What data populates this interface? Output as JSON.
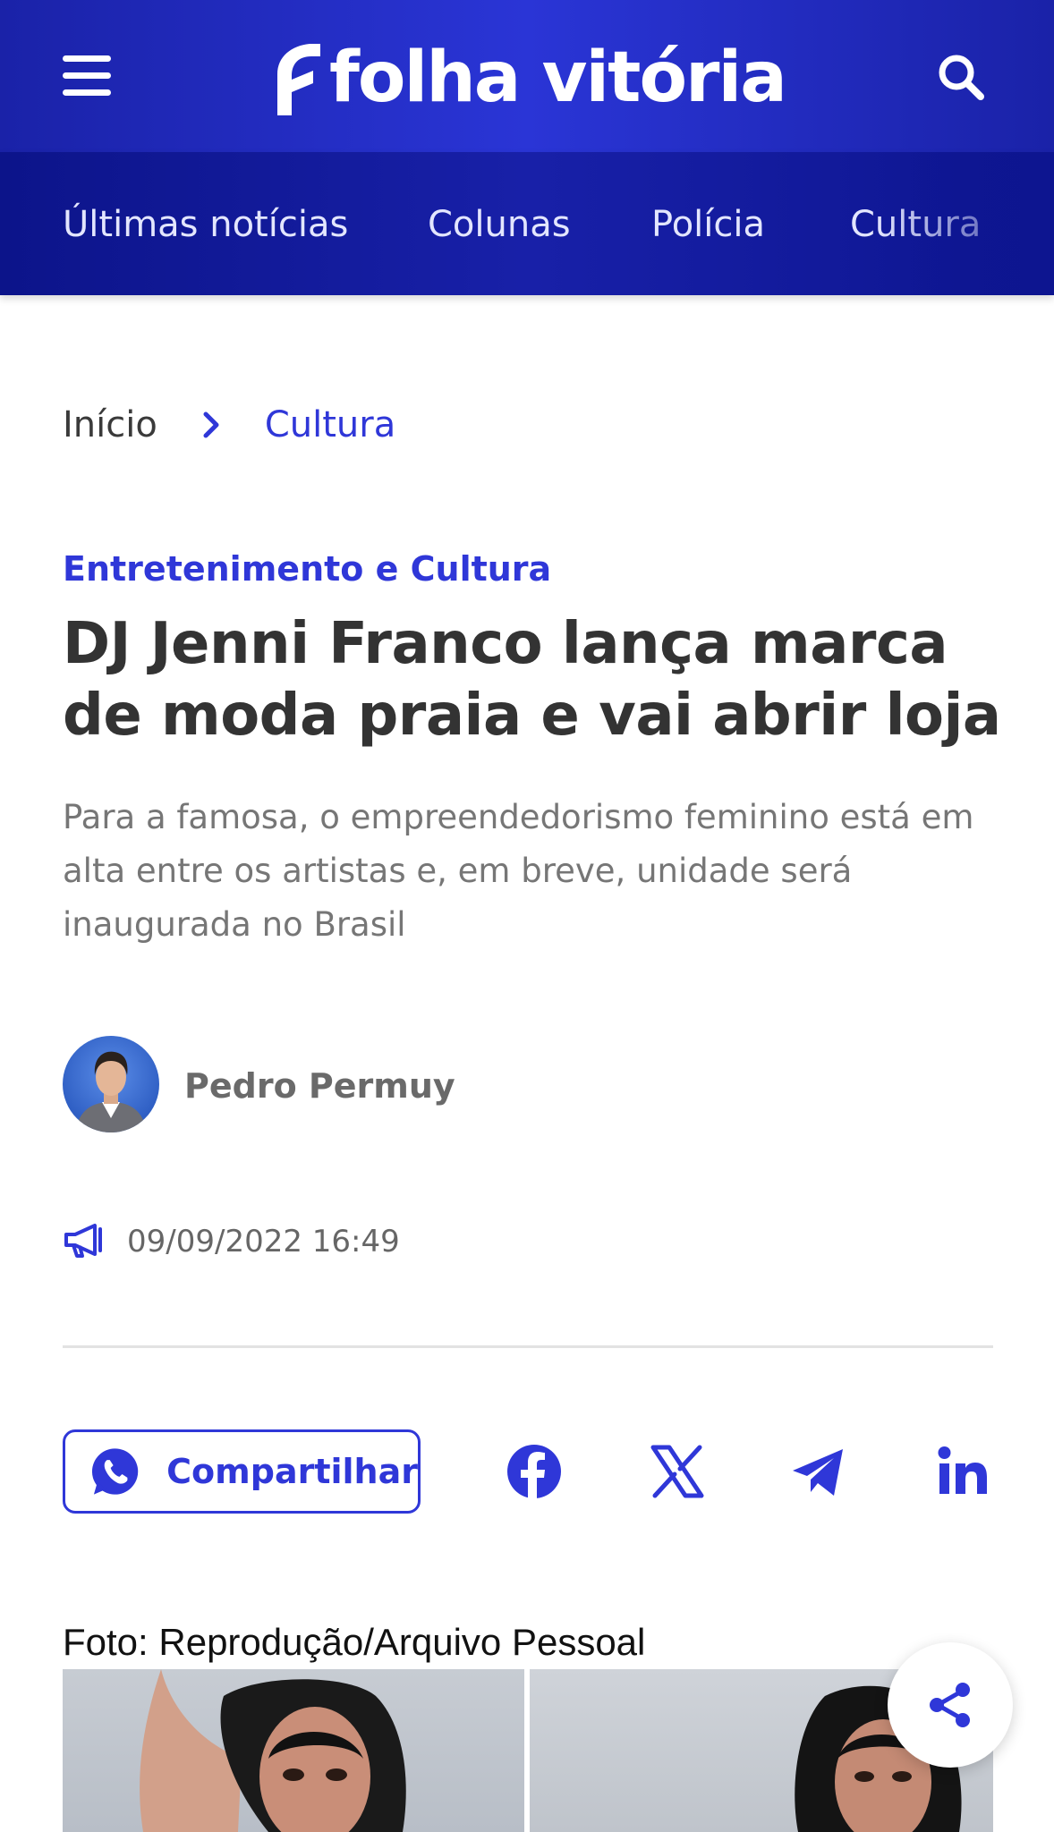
{
  "header": {
    "brand": "folha vitória",
    "menu_icon": "hamburger-menu-icon",
    "search_icon": "search-icon",
    "bg_color": "#1f29c2"
  },
  "nav": {
    "items": [
      {
        "label": "Últimas notícias"
      },
      {
        "label": "Colunas"
      },
      {
        "label": "Polícia"
      },
      {
        "label": "Cultura"
      }
    ]
  },
  "breadcrumb": {
    "home": "Início",
    "current": "Cultura"
  },
  "article": {
    "category": "Entretenimento e Cultura",
    "headline": "DJ Jenni Franco lança marca de moda praia e vai abrir loja",
    "subtitle": "Para a famosa, o empreendedorismo feminino está em alta entre os artistas e, em breve, unidade será inaugurada no Brasil",
    "author": "Pedro Permuy",
    "date": "09/09/2022 16:49",
    "photo_credit": "Foto: Reprodução/Arquivo Pessoal"
  },
  "share": {
    "whatsapp_label": "Compartilhar",
    "icons": [
      "whatsapp-icon",
      "facebook-icon",
      "x-icon",
      "telegram-icon",
      "linkedin-icon",
      "share-icon"
    ]
  },
  "colors": {
    "accent": "#2f37d8",
    "text": "#333333",
    "muted": "#767676"
  }
}
